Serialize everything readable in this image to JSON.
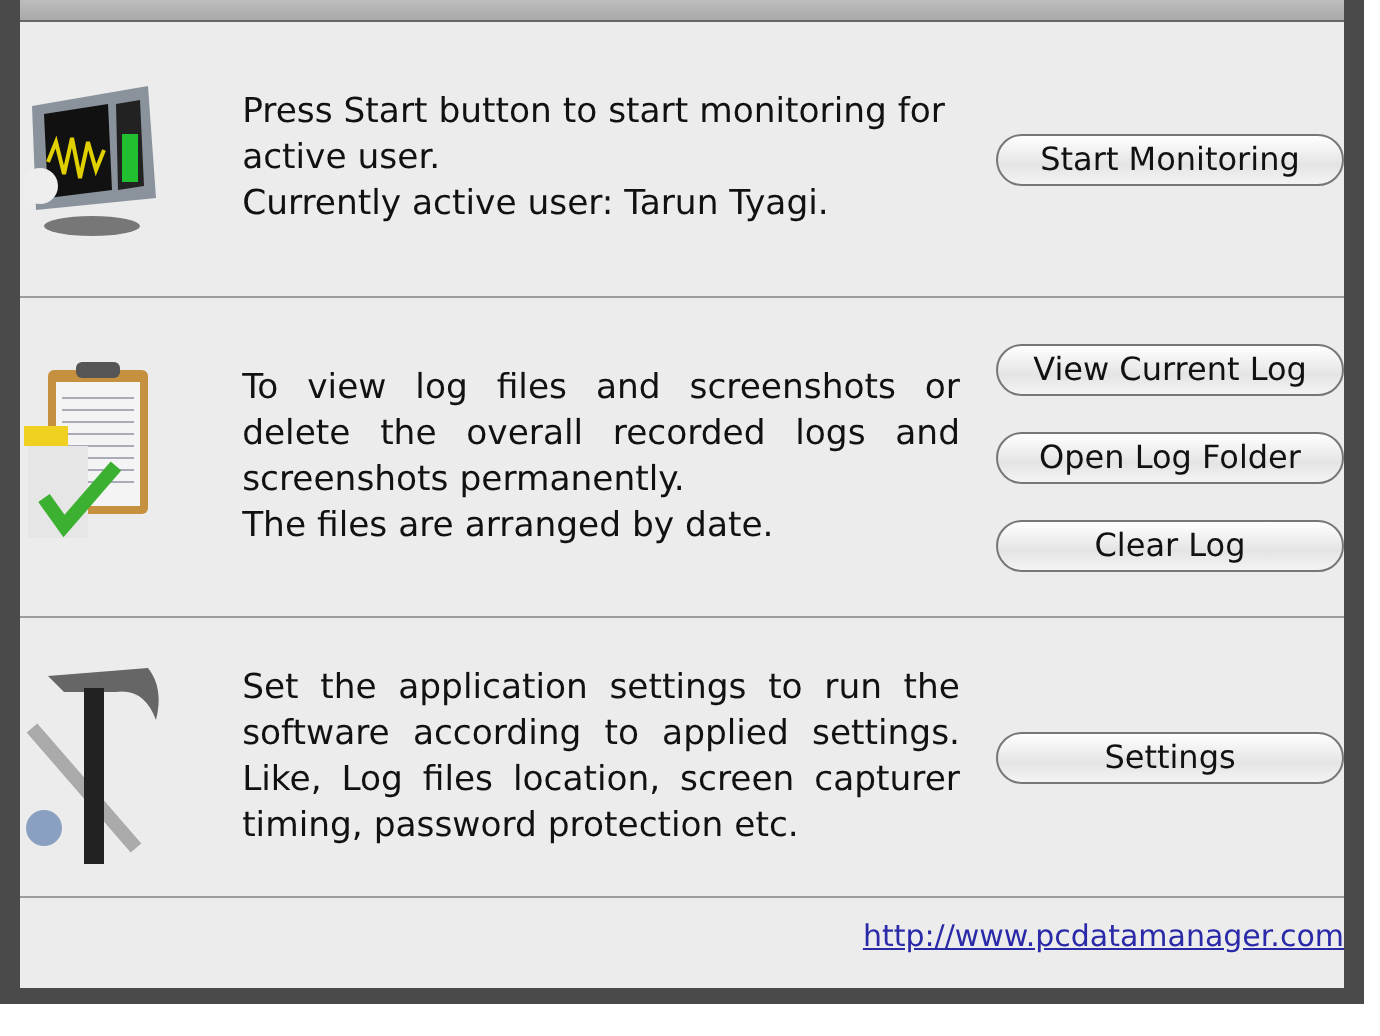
{
  "sections": [
    {
      "kind": "monitor",
      "lines": [
        "Press Start button to start monitoring for active user.",
        "Currently active user: Tarun Tyagi."
      ],
      "buttons": [
        "Start Monitoring"
      ]
    },
    {
      "kind": "clipboard",
      "lines": [
        "To view log files and screenshots or delete the overall recorded logs and screenshots permanently.",
        "The files are arranged by date."
      ],
      "buttons": [
        "View Current Log",
        "Open Log Folder",
        "Clear Log"
      ]
    },
    {
      "kind": "tools",
      "lines": [
        "Set the application settings to run the software according to applied settings. Like, Log files location, screen capturer timing, password protection etc."
      ],
      "buttons": [
        "Settings"
      ]
    }
  ],
  "footer": {
    "link": "http://www.pcdatamanager.com"
  }
}
